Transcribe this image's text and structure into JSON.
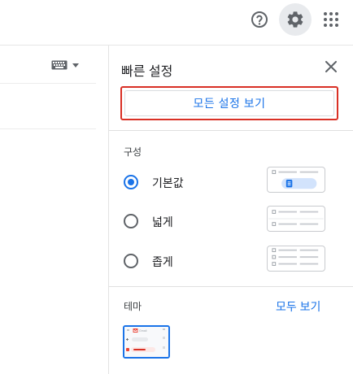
{
  "header": {
    "help_icon": "help-circle-icon",
    "settings_icon": "gear-icon",
    "apps_icon": "apps-grid-icon"
  },
  "main": {
    "input_tools_icon": "keyboard-icon"
  },
  "quick_settings": {
    "title": "빠른 설정",
    "close_icon": "close-icon",
    "see_all_settings": "모든 설정 보기",
    "density": {
      "label": "구성",
      "options": [
        {
          "label": "기본값",
          "selected": true
        },
        {
          "label": "넓게",
          "selected": false
        },
        {
          "label": "좁게",
          "selected": false
        }
      ]
    },
    "theme": {
      "label": "테마",
      "see_all": "모두 보기",
      "preview_app_name": "Gmail"
    }
  },
  "colors": {
    "accent": "#1a73e8",
    "highlight": "#d93025",
    "brand_red": "#ea4335"
  }
}
